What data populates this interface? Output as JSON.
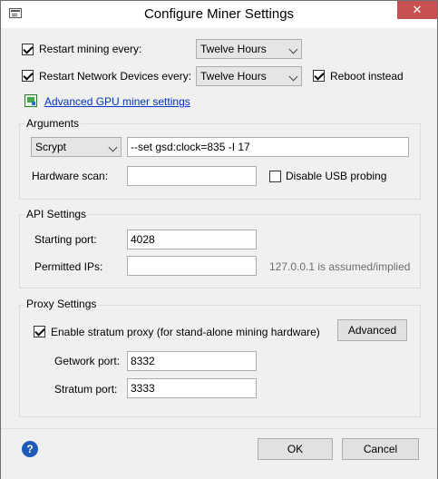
{
  "window": {
    "title": "Configure Miner Settings",
    "close_glyph": "✕"
  },
  "restart_mining": {
    "label": "Restart mining every:",
    "checked": true,
    "value": "Twelve Hours"
  },
  "restart_network": {
    "label": "Restart Network Devices every:",
    "checked": true,
    "value": "Twelve Hours"
  },
  "reboot_instead": {
    "label": "Reboot instead",
    "checked": true
  },
  "advanced_gpu_link": {
    "label": "Advanced GPU miner settings",
    "icon": "gpu-settings-icon"
  },
  "arguments": {
    "title": "Arguments",
    "algorithm": "Scrypt",
    "args_value": "--set gsd:clock=835 -I 17",
    "hardware_scan_label": "Hardware scan:",
    "hardware_scan_value": "",
    "disable_usb_label": "Disable USB probing",
    "disable_usb_checked": false
  },
  "api": {
    "title": "API Settings",
    "starting_port_label": "Starting port:",
    "starting_port_value": "4028",
    "permitted_ips_label": "Permitted IPs:",
    "permitted_ips_value": "",
    "permitted_ips_hint": "127.0.0.1 is assumed/implied"
  },
  "proxy": {
    "title": "Proxy Settings",
    "enable_label": "Enable stratum proxy (for stand-alone mining hardware)",
    "enable_checked": true,
    "advanced_label": "Advanced",
    "getwork_port_label": "Getwork port:",
    "getwork_port_value": "8332",
    "stratum_port_label": "Stratum port:",
    "stratum_port_value": "3333"
  },
  "footer": {
    "help_glyph": "?",
    "ok_label": "OK",
    "cancel_label": "Cancel"
  }
}
